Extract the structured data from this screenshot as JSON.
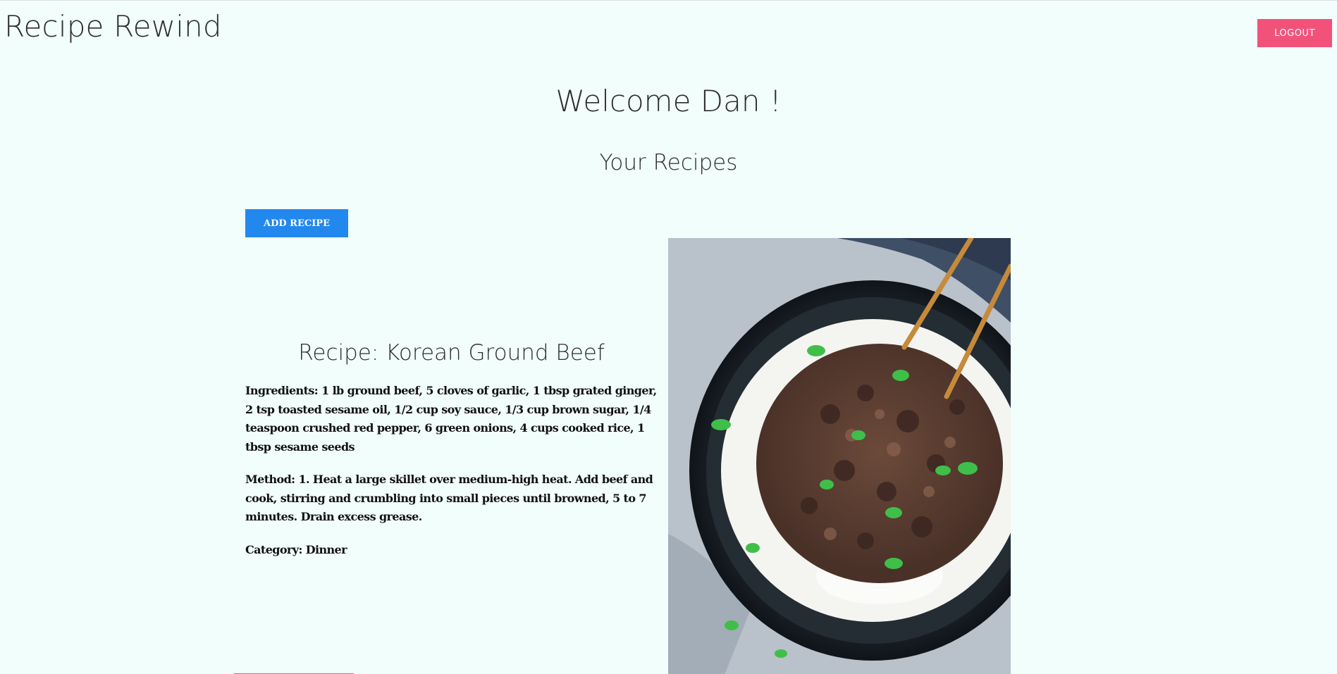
{
  "header": {
    "app_title": "Recipe Rewind",
    "logout_label": "LOGOUT"
  },
  "main": {
    "welcome": "Welcome Dan !",
    "section_title": "Your Recipes",
    "add_recipe_label": "ADD RECIPE"
  },
  "recipes": [
    {
      "title": "Recipe: Korean Ground Beef",
      "ingredients": "Ingredients: 1 lb ground beef, 5 cloves of garlic, 1 tbsp grated ginger, 2 tsp toasted sesame oil, 1/2 cup soy sauce, 1/3 cup brown sugar, 1/4 teaspoon crushed red pepper, 6 green onions, 4 cups cooked rice, 1 tbsp sesame seeds",
      "method": "Method: 1. Heat a large skillet over medium-high heat. Add beef and cook, stirring and crumbling into small pieces until browned, 5 to 7 minutes. Drain excess grease.",
      "category": "Category: Dinner",
      "image_icon": "food-photo"
    }
  ],
  "colors": {
    "background": "#f2fefb",
    "logout": "#f2527a",
    "add_recipe": "#2288ee"
  }
}
